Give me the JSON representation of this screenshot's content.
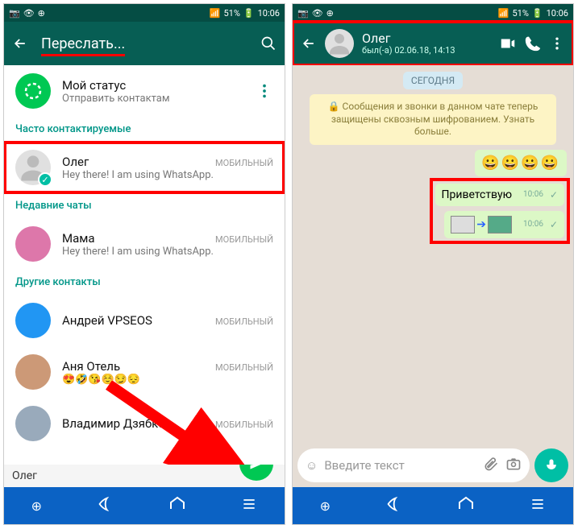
{
  "statusbar": {
    "signal": "51%",
    "time": "10:06"
  },
  "left": {
    "header_title": "Переслать...",
    "status": {
      "title": "Мой статус",
      "sub": "Отправить контактам"
    },
    "section_freq": "Часто контактируемые",
    "oleg": {
      "name": "Олег",
      "tag": "МОБИЛЬНЫЙ",
      "sub": "Hey there! I am using WhatsApp."
    },
    "section_recent": "Недавние чаты",
    "mama": {
      "name": "Мама",
      "tag": "МОБИЛЬНЫЙ",
      "sub": "Hey there! I am using WhatsApp."
    },
    "section_other": "Другие контакты",
    "andrei": {
      "name": "Андрей VPSEOS",
      "tag": "МОБИЛЬНЫЙ"
    },
    "anya": {
      "name": "Аня Отель",
      "tag": "МОБИЛЬНЫЙ",
      "emoji": "😍🤣😘☺️😏😔"
    },
    "vladimir": {
      "name": "Владимир Дзябко",
      "tag": "МОБИЛЬНЫЙ"
    },
    "chip": "Олег"
  },
  "right": {
    "name": "Олег",
    "lastseen": "был(-а) 02.06.18, 14:13",
    "day": "СЕГОДНЯ",
    "encrypt": "🔒 Сообщения и звонки в данном чате теперь защищены сквозным шифрованием. Узнать больше.",
    "msg1_emoji": "😀😀😀😀",
    "msg2": "Приветствую",
    "msg_time": "10:06",
    "input_placeholder": "Введите текст"
  }
}
